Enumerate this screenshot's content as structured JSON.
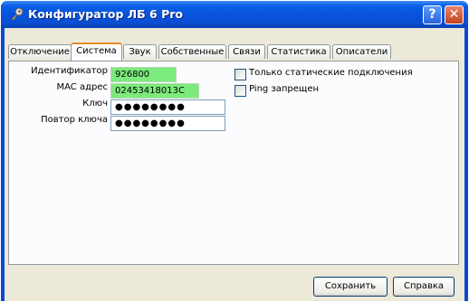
{
  "window": {
    "title": "Конфигуратор ЛБ 6 Pro",
    "help_label": "?",
    "close_label": "✕"
  },
  "tabs": [
    {
      "label": "Отключение"
    },
    {
      "label": "Система"
    },
    {
      "label": "Звук"
    },
    {
      "label": "Собственные"
    },
    {
      "label": "Связи"
    },
    {
      "label": "Статистика"
    },
    {
      "label": "Описатели"
    }
  ],
  "active_tab": "Система",
  "form": {
    "identifier_label": "Идентификатор",
    "identifier_value": "926800",
    "mac_label": "MAC адрес",
    "mac_value": "02453418013C",
    "key_label": "Ключ",
    "key_value": "●●●●●●●●",
    "key_repeat_label": "Повтор ключа",
    "key_repeat_value": "●●●●●●●●"
  },
  "options": {
    "static_only_label": "Только статические подключения",
    "static_only_checked": false,
    "ping_denied_label": "Ping запрещен",
    "ping_denied_checked": false
  },
  "buttons": {
    "save_label": "Сохранить",
    "help_label": "Справка"
  },
  "colors": {
    "titlebar": "#0a5fe8",
    "field_highlight": "#7dea7d",
    "active_tab_accent": "#e68b2c"
  }
}
